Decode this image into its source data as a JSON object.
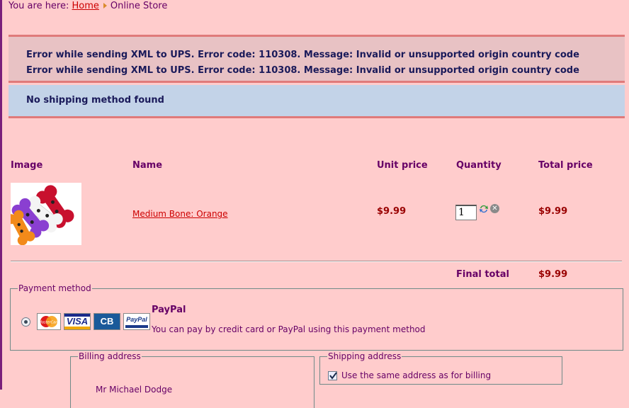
{
  "breadcrumb": {
    "prefix": "You are here:",
    "home": "Home",
    "current": "Online Store"
  },
  "messages": {
    "errors": [
      "Error while sending XML to UPS. Error code: 110308. Message: Invalid or unsupported origin country code",
      "Error while sending XML to UPS. Error code: 110308. Message: Invalid or unsupported origin country code"
    ],
    "notice": "No shipping method found"
  },
  "cart": {
    "columns": {
      "image": "Image",
      "name": "Name",
      "unit_price": "Unit price",
      "quantity": "Quantity",
      "total_price": "Total price"
    },
    "items": [
      {
        "name": "Medium Bone: Orange",
        "unit_price": "$9.99",
        "quantity": "1",
        "total_price": "$9.99"
      }
    ],
    "final_total_label": "Final total",
    "final_total": "$9.99"
  },
  "payment": {
    "legend": "Payment method",
    "method_name": "PayPal",
    "description": "You can pay by credit card or PayPal using this payment method",
    "cards": {
      "mastercard": "MasterCard",
      "visa": "VISA",
      "cb": "CB",
      "paypal": "PayPal"
    }
  },
  "billing": {
    "legend": "Billing address",
    "name": "Mr Michael Dodge"
  },
  "shipping": {
    "legend": "Shipping address",
    "same_as_billing": "Use the same address as for billing"
  },
  "colors": {
    "background": "#ffcccc",
    "error_bg": "#e8c2c4",
    "notice_bg": "#c3d3e8",
    "price": "#990000",
    "link": "#cc0000"
  }
}
